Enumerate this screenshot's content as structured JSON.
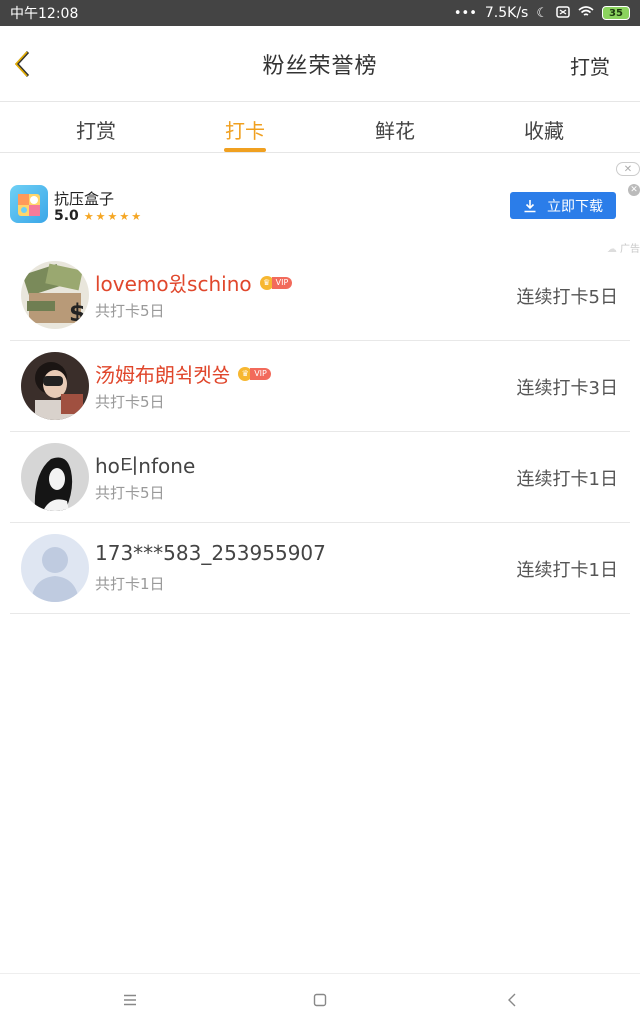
{
  "status_bar": {
    "time": "中午12:08",
    "network_speed": "7.5K/s",
    "battery": "35",
    "icons": [
      "moon-icon",
      "sim-icon",
      "wifi-icon",
      "battery-icon"
    ]
  },
  "header": {
    "title": "粉丝荣誉榜",
    "action": "打赏",
    "back_icon": "chevron-left-icon"
  },
  "tabs": [
    {
      "label": "打赏"
    },
    {
      "label": "打卡"
    },
    {
      "label": "鲜花"
    },
    {
      "label": "收藏"
    }
  ],
  "active_tab": "打卡",
  "ad": {
    "app_name": "抗压盒子",
    "rating": "5.0",
    "stars": "★★★★★",
    "download_label": "立即下载",
    "ad_label": "广告"
  },
  "fans": [
    {
      "name": "lovemo윘schino",
      "vip": true,
      "total": "共打卡5日",
      "streak": "连续打卡5日"
    },
    {
      "name": "汤姆布朗쉭켓쑹",
      "vip": true,
      "total": "共打卡5日",
      "streak": "连续打卡3日"
    },
    {
      "name": "ho티nfone",
      "vip": false,
      "total": "共打卡5日",
      "streak": "连续打卡1日"
    },
    {
      "name": "173***583_253955907",
      "vip": false,
      "total": "共打卡1日",
      "streak": "连续打卡1日"
    }
  ],
  "vip_text": "VIP",
  "nav": [
    "menu-icon",
    "home-icon",
    "back-icon"
  ],
  "colors": {
    "accent": "#f0a020",
    "vip_name": "#e0472c",
    "download_button": "#2b7de9",
    "status_bar": "#444444"
  }
}
